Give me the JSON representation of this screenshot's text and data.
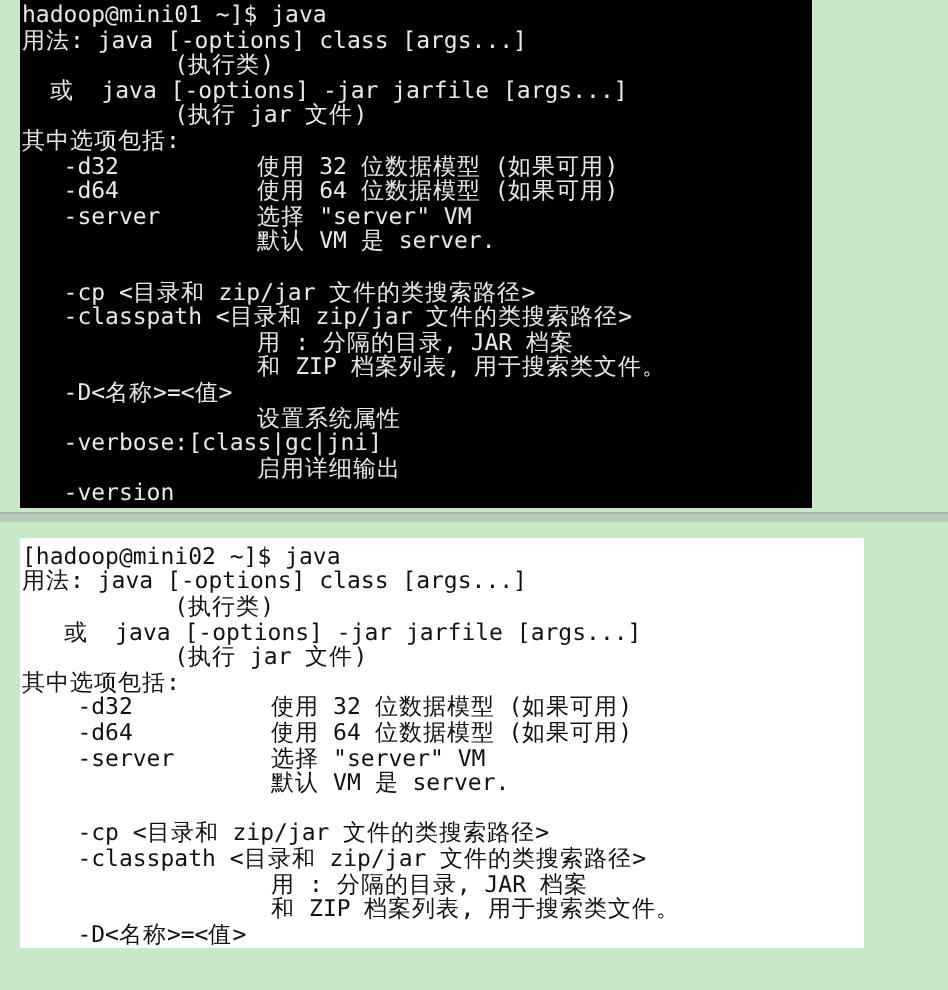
{
  "terminals": [
    {
      "dark": true,
      "lines": [
        {
          "text": "hadoop@mini01 ~]$ java"
        },
        {
          "text": "用法: java [-options] class [args...]"
        },
        {
          "text": "           (执行类)"
        },
        {
          "text": "  或  java [-options] -jar jarfile [args...]"
        },
        {
          "text": "           (执行 jar 文件)"
        },
        {
          "text": "其中选项包括:"
        },
        {
          "text": "   -d32          使用 32 位数据模型 (如果可用)"
        },
        {
          "text": "   -d64          使用 64 位数据模型 (如果可用)"
        },
        {
          "text": "   -server       选择 \"server\" VM"
        },
        {
          "text": "                 默认 VM 是 server."
        },
        {
          "text": "   -cp <目录和 zip/jar 文件的类搜索路径>",
          "gap_before": true
        },
        {
          "text": "   -classpath <目录和 zip/jar 文件的类搜索路径>"
        },
        {
          "text": "                 用 : 分隔的目录, JAR 档案"
        },
        {
          "text": "                 和 ZIP 档案列表, 用于搜索类文件。"
        },
        {
          "text": "   -D<名称>=<值>"
        },
        {
          "text": "                 设置系统属性"
        },
        {
          "text": "   -verbose:[class|gc|jni]"
        },
        {
          "text": "                 启用详细输出"
        },
        {
          "text": "   -version"
        }
      ]
    },
    {
      "dark": false,
      "lines": [
        {
          "text": "[hadoop@mini02 ~]$ java"
        },
        {
          "text": "用法: java [-options] class [args...]"
        },
        {
          "text": "           (执行类)"
        },
        {
          "text": "   或  java [-options] -jar jarfile [args...]"
        },
        {
          "text": "           (执行 jar 文件)"
        },
        {
          "text": "其中选项包括:"
        },
        {
          "text": "    -d32          使用 32 位数据模型 (如果可用)"
        },
        {
          "text": "    -d64          使用 64 位数据模型 (如果可用)"
        },
        {
          "text": "    -server       选择 \"server\" VM"
        },
        {
          "text": "                  默认 VM 是 server."
        },
        {
          "text": "    -cp <目录和 zip/jar 文件的类搜索路径>",
          "gap_before": true
        },
        {
          "text": "    -classpath <目录和 zip/jar 文件的类搜索路径>"
        },
        {
          "text": "                  用 : 分隔的目录, JAR 档案"
        },
        {
          "text": "                  和 ZIP 档案列表, 用于搜索类文件。"
        },
        {
          "text": "    -D<名称>=<值>"
        }
      ]
    }
  ]
}
